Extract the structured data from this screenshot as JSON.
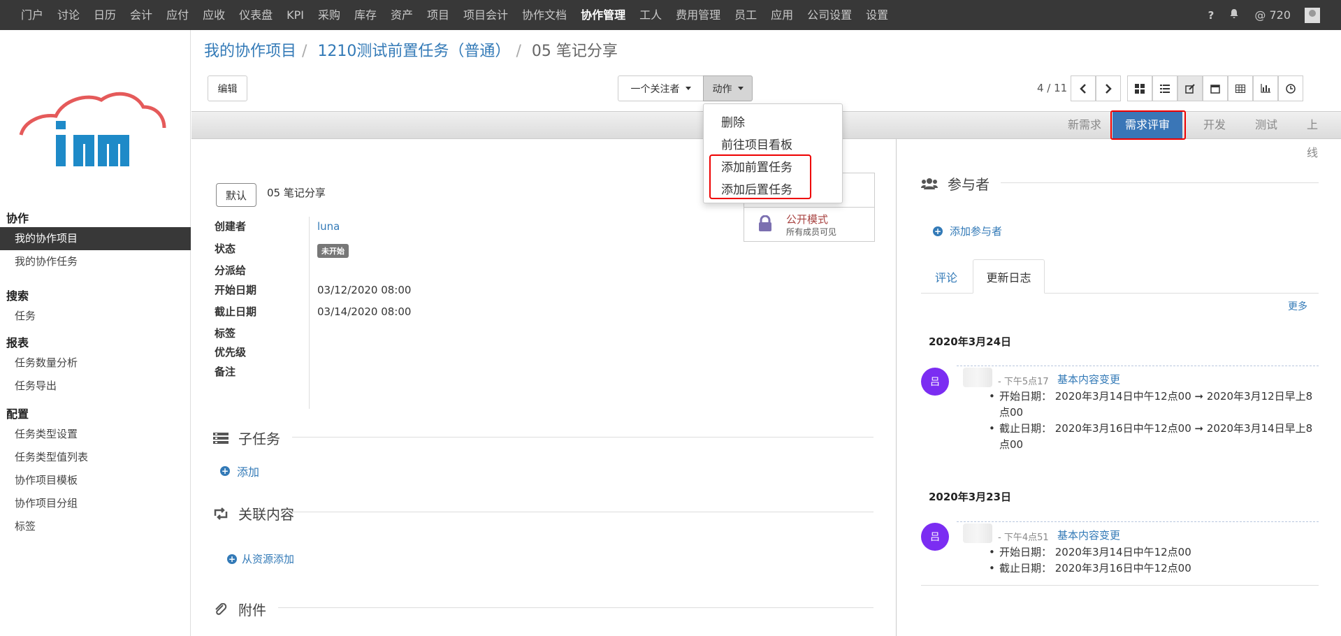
{
  "topnav": {
    "items": [
      "门户",
      "讨论",
      "日历",
      "会计",
      "应付",
      "应收",
      "仪表盘",
      "KPI",
      "采购",
      "库存",
      "资产",
      "项目",
      "项目会计",
      "协作文档",
      "协作管理",
      "工人",
      "费用管理",
      "员工",
      "应用",
      "公司设置",
      "设置"
    ],
    "active_index": 14,
    "help": "?",
    "notif": "🔔",
    "at_count": "@ 720"
  },
  "sidebar": {
    "logo_text": "im",
    "sections": [
      {
        "title": "协作",
        "items": [
          "我的协作项目",
          "我的协作任务"
        ]
      },
      {
        "title": "搜索",
        "items": [
          "任务"
        ]
      },
      {
        "title": "报表",
        "items": [
          "任务数量分析",
          "任务导出"
        ]
      },
      {
        "title": "配置",
        "items": [
          "任务类型设置",
          "任务类型值列表",
          "协作项目模板",
          "协作项目分组",
          "标签"
        ]
      }
    ],
    "active_item": "我的协作项目"
  },
  "breadcrumb": {
    "root": "我的协作项目",
    "project": "1210测试前置任务（普通）",
    "current": "05 笔记分享"
  },
  "toolbar": {
    "edit": "编辑",
    "followers": "一个关注者",
    "actions": "动作",
    "pager": "4 / 11"
  },
  "dropdown": {
    "items": [
      "删除",
      "前往项目看板",
      "添加前置任务",
      "添加后置任务"
    ]
  },
  "stages": [
    "新需求",
    "需求评审",
    "开发",
    "测试",
    "上线"
  ],
  "active_stage": "需求评审",
  "form": {
    "tag": "默认",
    "title": "05 笔记分享",
    "labels": {
      "creator": "创建者",
      "status": "状态",
      "assigned": "分派给",
      "start": "开始日期",
      "end": "截止日期",
      "tags": "标签",
      "priority": "优先级",
      "note": "备注"
    },
    "values": {
      "creator": "luna",
      "status": "未开始",
      "start": "03/12/2020 08:00",
      "end": "03/14/2020 08:00"
    },
    "privacy": {
      "title": "公开模式",
      "subtitle": "所有成员可见"
    },
    "subtasks": "子任务",
    "add": "添加",
    "related": "关联内容",
    "add_from_res": "从资源添加",
    "attachments": "附件"
  },
  "right": {
    "participants": "参与者",
    "add_participant": "添加参与者",
    "tab_comment": "评论",
    "tab_log": "更新日志",
    "more": "更多",
    "logs": [
      {
        "date": "2020年3月24日",
        "avatar": "吕",
        "time": "- 下午5点17",
        "title": "基本内容变更",
        "lines": [
          "开始日期： 2020年3月14日中午12点00 ➞ 2020年3月12日早上8点00",
          "截止日期： 2020年3月16日中午12点00 ➞ 2020年3月14日早上8点00"
        ]
      },
      {
        "date": "2020年3月23日",
        "avatar": "吕",
        "time": "- 下午4点51",
        "title": "基本内容变更",
        "lines": [
          "开始日期： 2020年3月14日中午12点00",
          "截止日期： 2020年3月16日中午12点00"
        ]
      }
    ]
  },
  "colors": {
    "accent": "#337ab7",
    "nav_bg": "#383838",
    "stage_active": "#3a76b7",
    "highlight": "#e00000",
    "avatar": "#7b2df2"
  }
}
